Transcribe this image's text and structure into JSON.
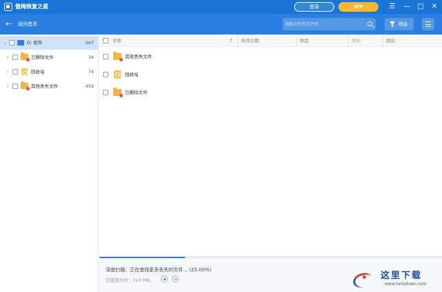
{
  "app": {
    "title": "傲梅恢复之星"
  },
  "titlebar": {
    "login_label": "登录",
    "vip_label": "VIP",
    "menu_glyph": "☰",
    "minimize_glyph": "—",
    "maximize_glyph": "□",
    "close_glyph": "✕"
  },
  "nav": {
    "back_label": "返回首页",
    "search_placeholder": "搜索文件和文件夹",
    "filter_label": "筛选"
  },
  "sidebar": {
    "items": [
      {
        "label": "D: 软件",
        "count": "567",
        "icon": "drive-icon",
        "selected": true
      },
      {
        "label": "已删除文件",
        "count": "34",
        "icon": "folder-icon"
      },
      {
        "label": "回收站",
        "count": "74",
        "icon": "recycle-bin-icon"
      },
      {
        "label": "其他丢失文件",
        "count": "459",
        "icon": "folder-icon"
      }
    ]
  },
  "table": {
    "columns": [
      "名称",
      "修改日期",
      "类型",
      "大小",
      "路径"
    ],
    "rows": [
      {
        "name": "其他丢失文件",
        "icon": "folder-icon"
      },
      {
        "name": "回收站",
        "icon": "recycle-bin-icon"
      },
      {
        "name": "已删除文件",
        "icon": "folder-icon"
      }
    ]
  },
  "status": {
    "scan_text": "深度扫描：正在查找更多丢失的文件... (25.00%)",
    "found_text": "已找到文件：310 MB。",
    "progress": 0.25
  },
  "watermark": {
    "text": "这里下载",
    "url": "www.heredown.com"
  },
  "colors": {
    "titlebar": "#1976d6",
    "navbar": "#2a7fe0",
    "vip": "#f7b731",
    "accent": "#2f7fe0",
    "selected_row": "#cfe3fb"
  }
}
